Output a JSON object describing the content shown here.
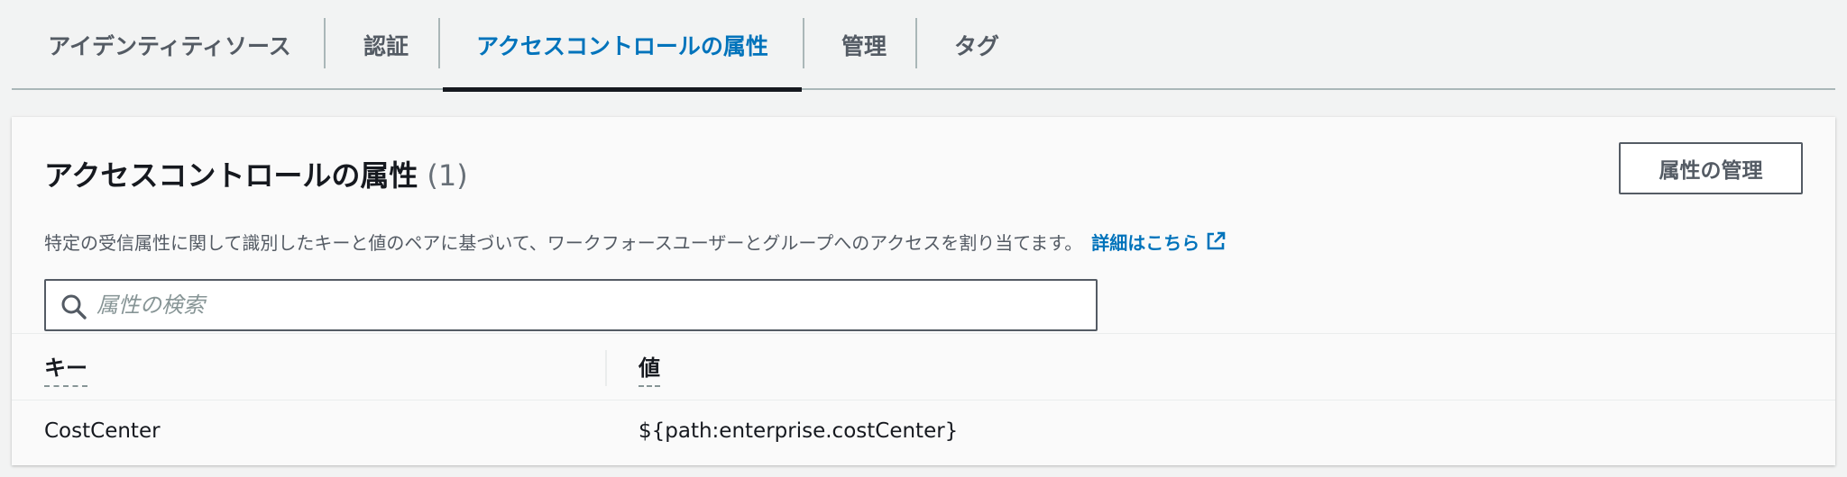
{
  "tabs": [
    {
      "label": "アイデンティティソース",
      "active": false
    },
    {
      "label": "認証",
      "active": false
    },
    {
      "label": "アクセスコントロールの属性",
      "active": true
    },
    {
      "label": "管理",
      "active": false
    },
    {
      "label": "タグ",
      "active": false
    }
  ],
  "panel": {
    "title": "アクセスコントロールの属性",
    "count": "(1)",
    "description": "特定の受信属性に関して識別したキーと値のペアに基づいて、ワークフォースユーザーとグループへのアクセスを割り当てます。",
    "learn_more": "詳細はこちら",
    "manage_button": "属性の管理"
  },
  "search": {
    "placeholder": "属性の検索",
    "value": ""
  },
  "table": {
    "columns": [
      "キー",
      "値"
    ],
    "rows": [
      {
        "key": "CostCenter",
        "value": "${path:enterprise.costCenter}"
      }
    ]
  },
  "colors": {
    "accent": "#0073bb",
    "text": "#16191f",
    "secondary": "#545b64",
    "background": "#f2f3f3"
  }
}
